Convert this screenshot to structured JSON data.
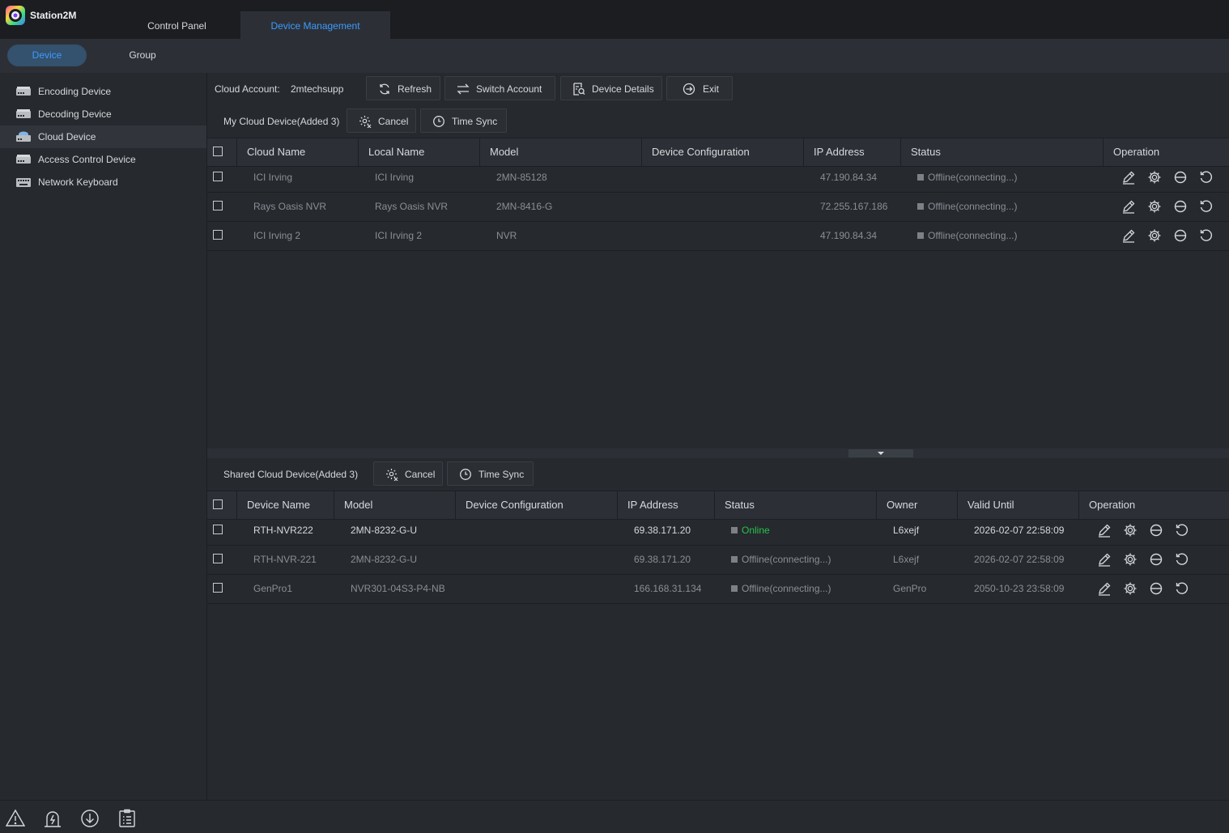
{
  "app": {
    "name": "Station2M"
  },
  "tabs": [
    {
      "label": "Control Panel",
      "active": false
    },
    {
      "label": "Device Management",
      "active": true
    }
  ],
  "subnav": {
    "device": "Device",
    "group": "Group"
  },
  "sidebar": {
    "items": [
      {
        "label": "Encoding Device",
        "icon": "server-icon"
      },
      {
        "label": "Decoding Device",
        "icon": "server-icon"
      },
      {
        "label": "Cloud Device",
        "icon": "cloud-server-icon",
        "active": true
      },
      {
        "label": "Access Control Device",
        "icon": "server-icon"
      },
      {
        "label": "Network Keyboard",
        "icon": "keyboard-icon"
      }
    ]
  },
  "toolbar": {
    "account_label": "Cloud Account:",
    "account_value": "2mtechsupp",
    "refresh": "Refresh",
    "switch_account": "Switch Account",
    "device_details": "Device Details",
    "exit": "Exit"
  },
  "my_cloud": {
    "title": "My Cloud Device(Added 3)",
    "cancel": "Cancel",
    "time_sync": "Time Sync",
    "columns": [
      "Cloud Name",
      "Local Name",
      "Model",
      "Device Configuration",
      "IP Address",
      "Status",
      "Operation"
    ],
    "rows": [
      {
        "cloud_name": "ICI Irving",
        "local_name": "ICI Irving",
        "model": "2MN-85128",
        "config": "",
        "ip": "47.190.84.34",
        "status": "Offline(connecting...)",
        "online": false
      },
      {
        "cloud_name": "Rays Oasis NVR",
        "local_name": "Rays Oasis NVR",
        "model": "2MN-8416-G",
        "config": "",
        "ip": "72.255.167.186",
        "status": "Offline(connecting...)",
        "online": false
      },
      {
        "cloud_name": "ICI Irving 2",
        "local_name": "ICI Irving 2",
        "model": "NVR",
        "config": "",
        "ip": "47.190.84.34",
        "status": "Offline(connecting...)",
        "online": false
      }
    ]
  },
  "shared_cloud": {
    "title": "Shared Cloud Device(Added 3)",
    "cancel": "Cancel",
    "time_sync": "Time Sync",
    "columns": [
      "Device Name",
      "Model",
      "Device Configuration",
      "IP Address",
      "Status",
      "Owner",
      "Valid Until",
      "Operation"
    ],
    "rows": [
      {
        "name": "RTH-NVR222",
        "model": "2MN-8232-G-U",
        "config": "",
        "ip": "69.38.171.20",
        "status": "Online",
        "online": true,
        "owner": "L6xejf",
        "valid_until": "2026-02-07 22:58:09"
      },
      {
        "name": "RTH-NVR-221",
        "model": "2MN-8232-G-U",
        "config": "",
        "ip": "69.38.171.20",
        "status": "Offline(connecting...)",
        "online": false,
        "owner": "L6xejf",
        "valid_until": "2026-02-07 22:58:09"
      },
      {
        "name": "GenPro1",
        "model": "NVR301-04S3-P4-NB",
        "config": "",
        "ip": "166.168.31.134",
        "status": "Offline(connecting...)",
        "online": false,
        "owner": "GenPro",
        "valid_until": "2050-10-23 23:58:09"
      }
    ]
  },
  "colors": {
    "accent": "#3d9bff",
    "online": "#27c24c",
    "offline": "#7d8187",
    "background": "#26292e"
  }
}
